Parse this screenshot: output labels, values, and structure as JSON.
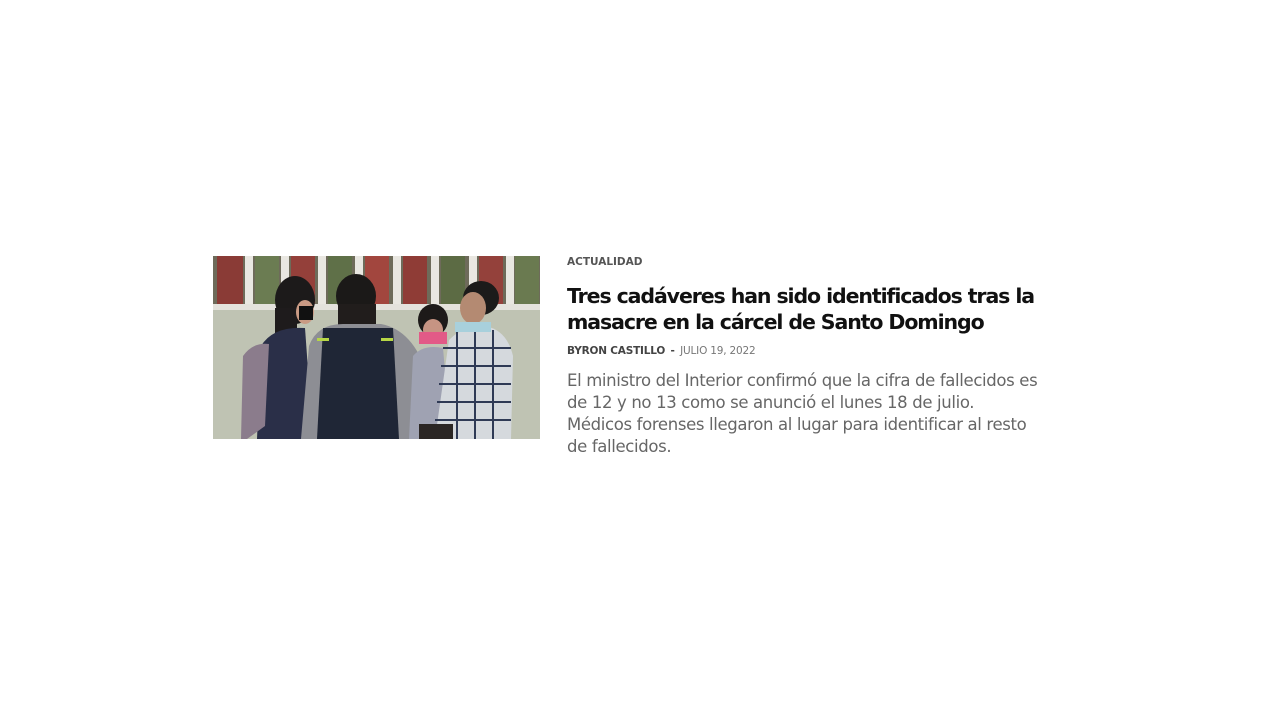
{
  "article": {
    "category": "ACTUALIDAD",
    "title": "Tres cadáveres han sido identificados tras la masacre en la cárcel de Santo Domingo",
    "author": "BYRON CASTILLO",
    "separator": "-",
    "date": "JULIO 19, 2022",
    "excerpt": "El ministro del Interior confirmó que la cifra de fallecidos es de 12 y no 13 como se anunció el lunes 18 de julio. Médicos forenses llegaron al lugar para identificar al resto de fallecidos.",
    "image": {
      "description_icon": "news-photo-icon"
    }
  },
  "colors": {
    "title": "#111111",
    "category": "#555555",
    "meta": "#777777",
    "excerpt": "#666666",
    "background": "#ffffff"
  }
}
